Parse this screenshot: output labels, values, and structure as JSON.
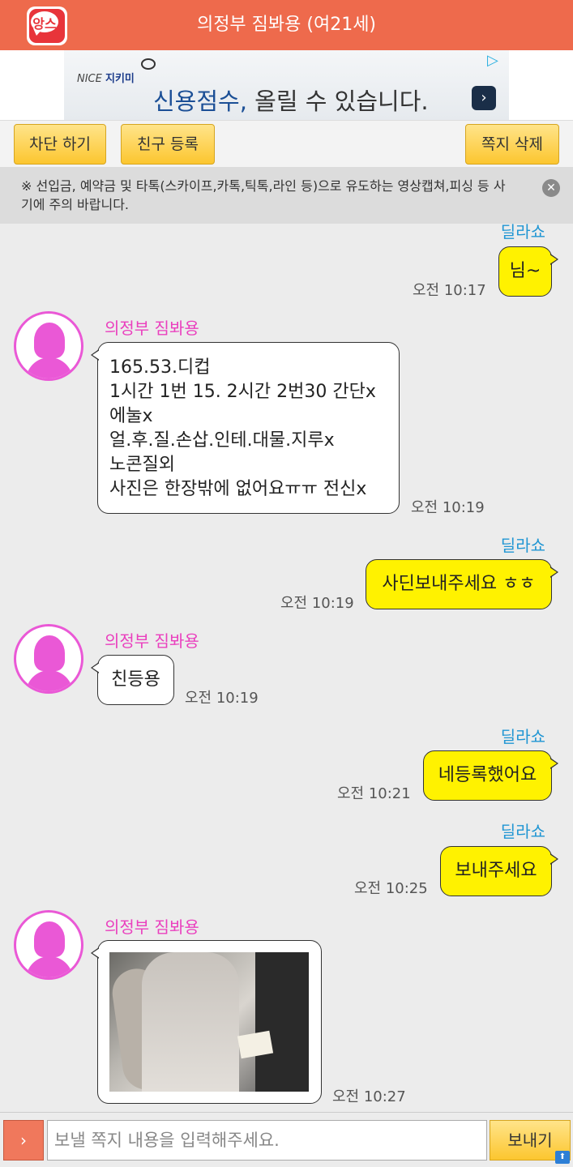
{
  "header": {
    "logo_text": "앙스",
    "title": "의정부 짐봐용 (여21세)"
  },
  "ad": {
    "brand_prefix": "NICE",
    "brand_name": "지키미",
    "headline_main": "신용점수,",
    "headline_rest": " 올릴 수 있습니다."
  },
  "actions": {
    "block_label": "차단 하기",
    "friend_label": "친구 등록",
    "delete_label": "쪽지 삭제"
  },
  "notice": {
    "text": "※ 선입금, 예약금 및 타톡(스카이프,카톡,틱톡,라인 등)으로 유도하는 영상캡쳐,피싱 등 사기에 주의 바랍니다."
  },
  "messages": [
    {
      "sender": "딜라쇼",
      "side": "me",
      "text": "님~",
      "time": "오전 10:17"
    },
    {
      "sender": "의정부 짐봐용",
      "side": "them",
      "text": "165.53.디컵\n1시간 1번 15. 2시간 2번30 간단x\n에눌x\n얼.후.질.손삽.인테.대물.지루x\n노콘질외\n사진은 한장밖에 없어요ㅠㅠ 전신x",
      "time": "오전 10:19"
    },
    {
      "sender": "딜라쇼",
      "side": "me",
      "text": "사딘보내주세요 ㅎㅎ",
      "time": "오전 10:19"
    },
    {
      "sender": "의정부 짐봐용",
      "side": "them",
      "text": "친등용",
      "time": "오전 10:19"
    },
    {
      "sender": "딜라쇼",
      "side": "me",
      "text": "네등록했어요",
      "time": "오전 10:21"
    },
    {
      "sender": "딜라쇼",
      "side": "me",
      "text": "보내주세요",
      "time": "오전 10:25"
    },
    {
      "sender": "의정부 짐봐용",
      "side": "them",
      "text": "",
      "time": "오전 10:27"
    }
  ],
  "input": {
    "placeholder": "보낼 쪽지 내용을 입력해주세요.",
    "send_label": "보내기",
    "expand_symbol": "›"
  },
  "colors": {
    "header_bg": "#ee6a4c",
    "my_bubble": "#fff200",
    "my_name": "#2196d3",
    "their_name": "#ea3fbe",
    "button_yellow": "#fcc62f"
  }
}
